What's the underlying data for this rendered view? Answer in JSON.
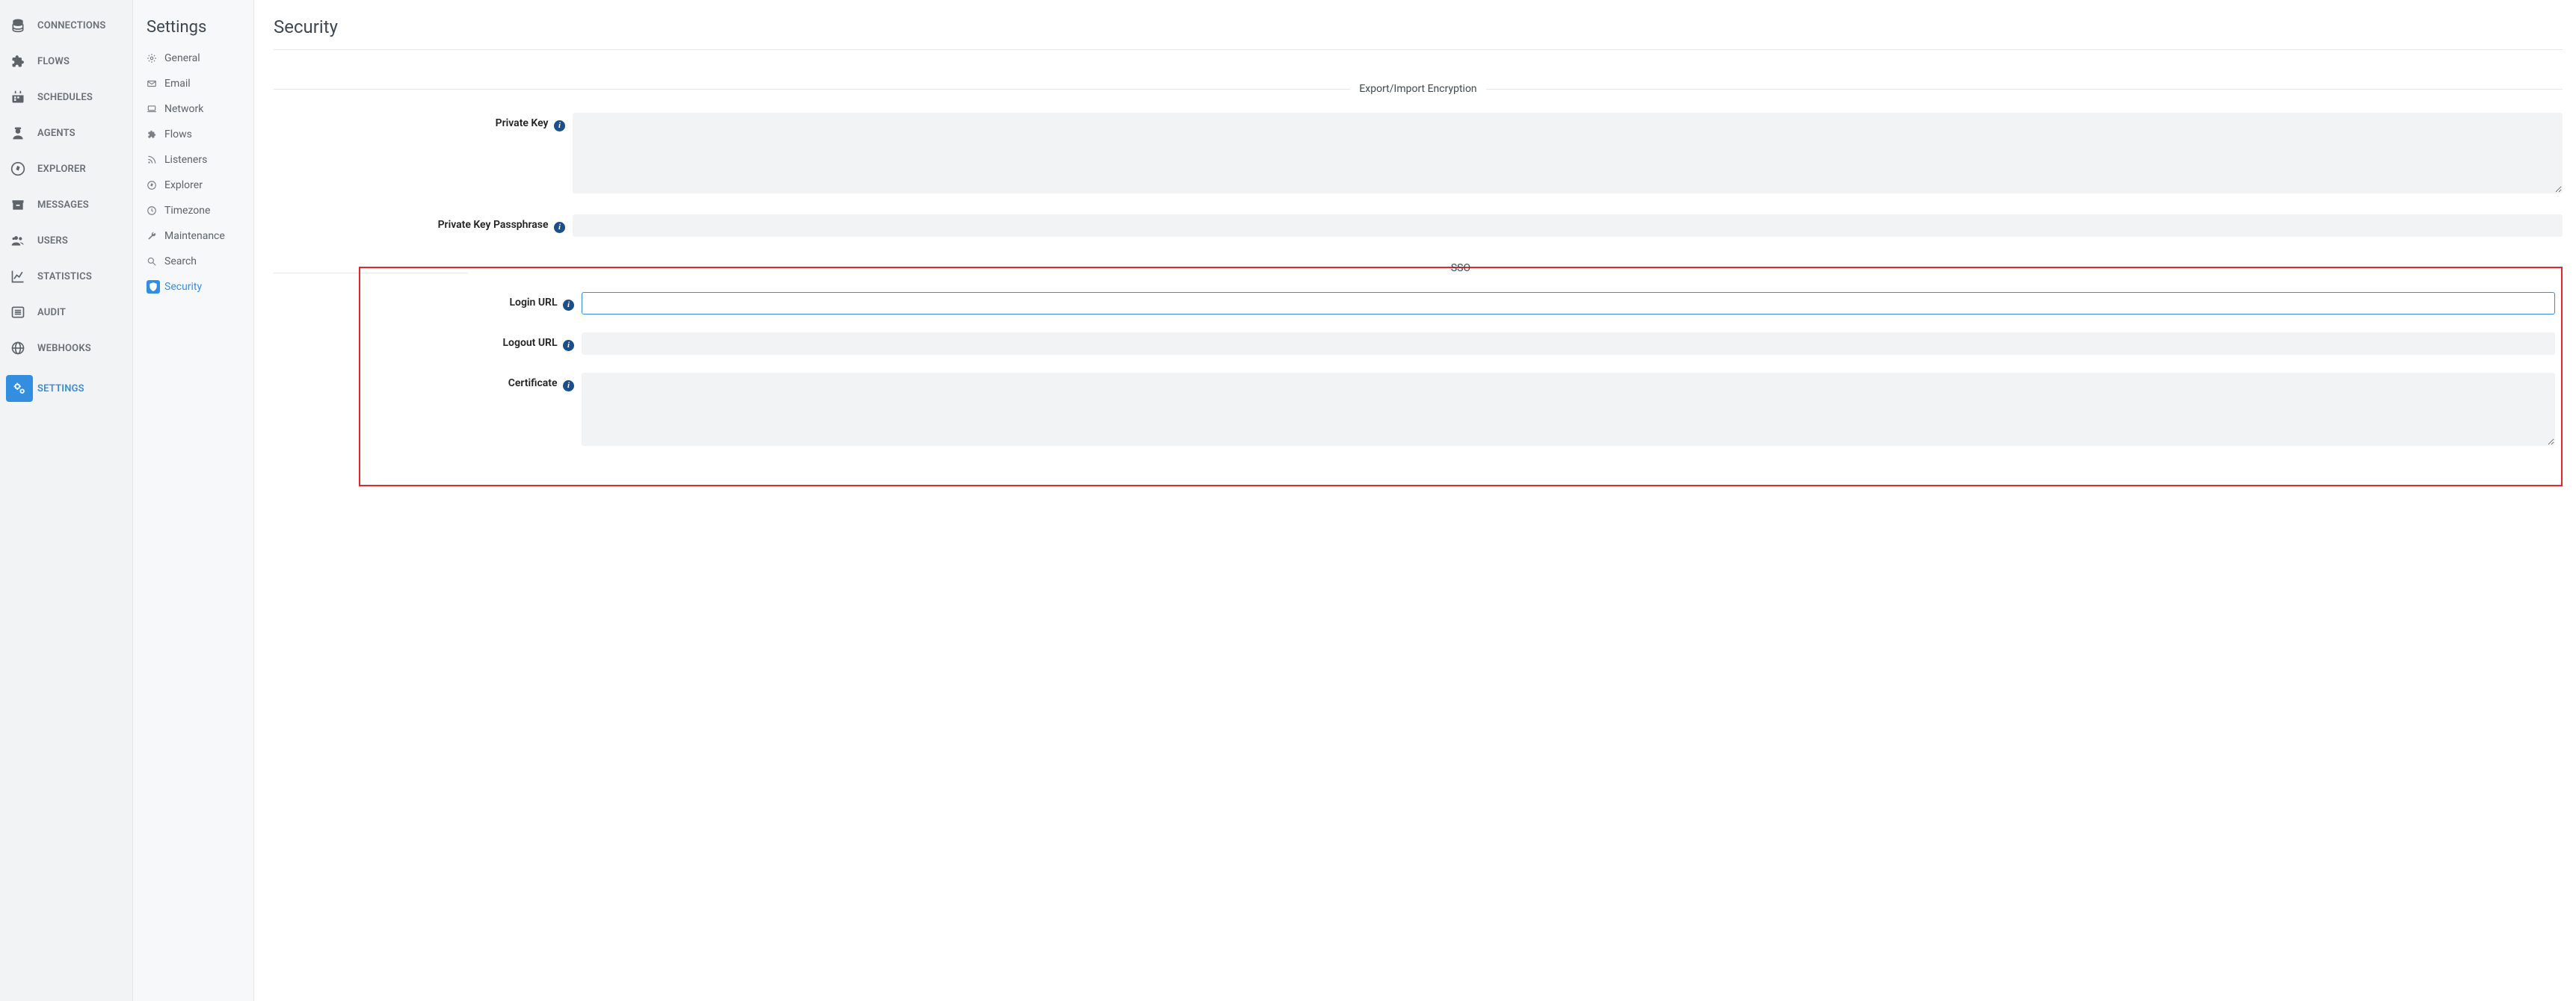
{
  "nav": {
    "items": [
      {
        "label": "CONNECTIONS",
        "icon": "database"
      },
      {
        "label": "FLOWS",
        "icon": "puzzle"
      },
      {
        "label": "SCHEDULES",
        "icon": "calendar"
      },
      {
        "label": "AGENTS",
        "icon": "agent"
      },
      {
        "label": "EXPLORER",
        "icon": "compass"
      },
      {
        "label": "MESSAGES",
        "icon": "archive"
      },
      {
        "label": "USERS",
        "icon": "users"
      },
      {
        "label": "STATISTICS",
        "icon": "chart"
      },
      {
        "label": "AUDIT",
        "icon": "list"
      },
      {
        "label": "WEBHOOKS",
        "icon": "globe"
      },
      {
        "label": "SETTINGS",
        "icon": "gears",
        "active": true
      }
    ]
  },
  "settings_nav": {
    "title": "Settings",
    "items": [
      {
        "label": "General",
        "icon": "gear"
      },
      {
        "label": "Email",
        "icon": "mail"
      },
      {
        "label": "Network",
        "icon": "laptop"
      },
      {
        "label": "Flows",
        "icon": "puzzle"
      },
      {
        "label": "Listeners",
        "icon": "rss"
      },
      {
        "label": "Explorer",
        "icon": "compass"
      },
      {
        "label": "Timezone",
        "icon": "clock"
      },
      {
        "label": "Maintenance",
        "icon": "wrench"
      },
      {
        "label": "Search",
        "icon": "search"
      },
      {
        "label": "Security",
        "icon": "shield",
        "active": true
      }
    ]
  },
  "page": {
    "title": "Security",
    "sections": {
      "encryption": {
        "legend": "Export/Import Encryption",
        "private_key_label": "Private Key",
        "private_key_value": "",
        "passphrase_label": "Private Key Passphrase",
        "passphrase_value": ""
      },
      "sso": {
        "legend": "SSO",
        "login_url_label": "Login URL",
        "login_url_value": "",
        "logout_url_label": "Logout URL",
        "logout_url_value": "",
        "certificate_label": "Certificate",
        "certificate_value": ""
      }
    }
  },
  "colors": {
    "accent": "#338ee0",
    "highlight_box": "#e1272a",
    "bg_input": "#f1f3f5"
  }
}
